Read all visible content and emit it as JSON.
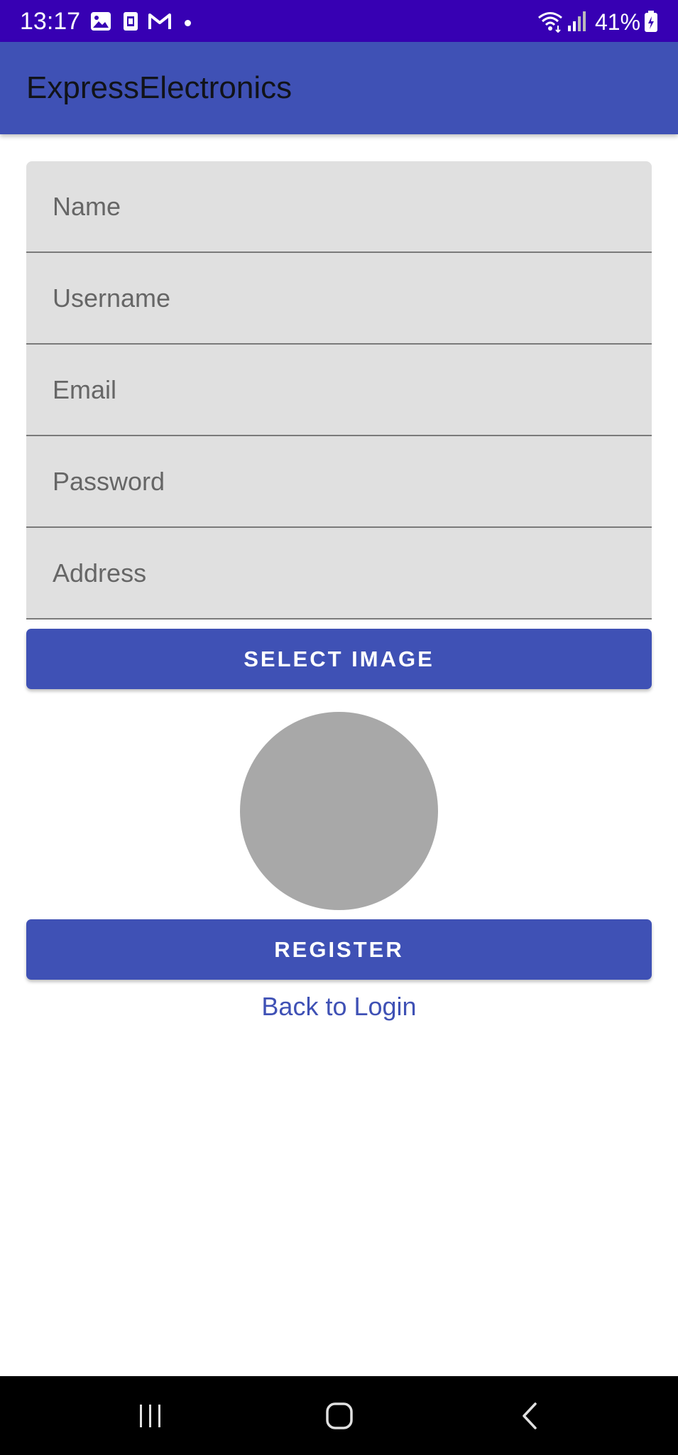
{
  "status_bar": {
    "time": "13:17",
    "battery": "41%",
    "icons_left": [
      "gallery-icon",
      "sim-card-icon",
      "gmail-icon"
    ],
    "icons_right": [
      "wifi-icon",
      "signal-icon",
      "battery-icon"
    ]
  },
  "app_bar": {
    "title": "ExpressElectronics",
    "color": "#3f51b5"
  },
  "form": {
    "fields": [
      {
        "name": "name",
        "placeholder": "Name",
        "value": ""
      },
      {
        "name": "username",
        "placeholder": "Username",
        "value": ""
      },
      {
        "name": "email",
        "placeholder": "Email",
        "value": ""
      },
      {
        "name": "password",
        "placeholder": "Password",
        "value": ""
      },
      {
        "name": "address",
        "placeholder": "Address",
        "value": ""
      }
    ],
    "select_image_label": "SELECT IMAGE",
    "register_label": "REGISTER",
    "back_to_login_label": "Back to Login"
  },
  "nav_bar": {
    "buttons": [
      "recent-apps-icon",
      "home-icon",
      "back-icon"
    ]
  },
  "colors": {
    "status_bar": "#3700b3",
    "primary": "#3f51b5",
    "field_bg": "#e0e0e0",
    "avatar_placeholder": "#a8a8a8"
  }
}
